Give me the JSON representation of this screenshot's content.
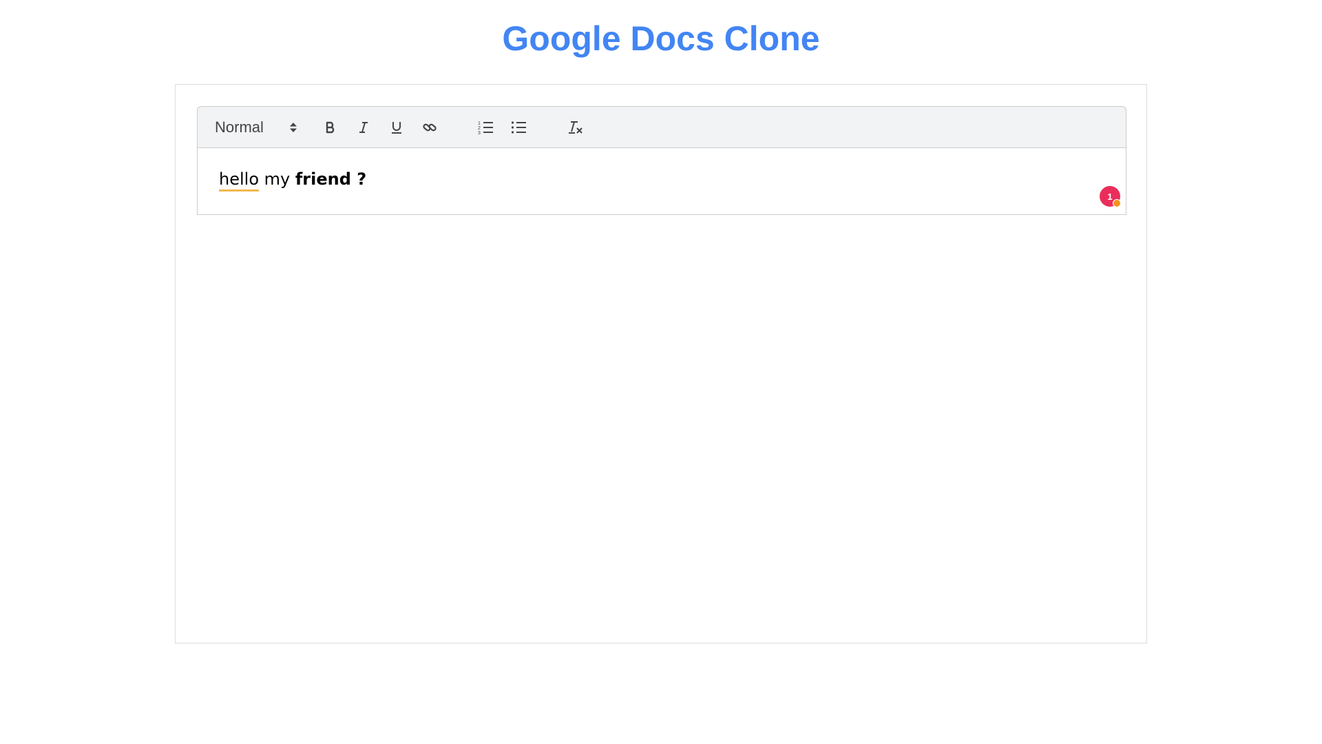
{
  "app": {
    "title": "Google Docs Clone",
    "accent_color": "#4285f4"
  },
  "toolbar": {
    "format_select": {
      "selected": "Normal",
      "icon": "chevron-up-down-icon"
    },
    "buttons": [
      {
        "name": "bold",
        "icon": "bold-icon"
      },
      {
        "name": "italic",
        "icon": "italic-icon"
      },
      {
        "name": "underline",
        "icon": "underline-icon"
      },
      {
        "name": "link",
        "icon": "link-icon"
      },
      {
        "name": "ordered-list",
        "icon": "ordered-list-icon"
      },
      {
        "name": "bullet-list",
        "icon": "bullet-list-icon"
      },
      {
        "name": "clear-formatting",
        "icon": "clear-formatting-icon"
      }
    ]
  },
  "document": {
    "segments": [
      {
        "text": "hello",
        "style": "spellcheck-underline"
      },
      {
        "text": " my ",
        "style": "normal"
      },
      {
        "text": "friend",
        "style": "bold"
      },
      {
        "text": " ?",
        "style": "bold"
      }
    ],
    "spellcheck_color": "#f3b74f"
  },
  "assistant_badge": {
    "count": "1",
    "color": "#ea2e5b",
    "status_dot_color": "#f7931e"
  }
}
